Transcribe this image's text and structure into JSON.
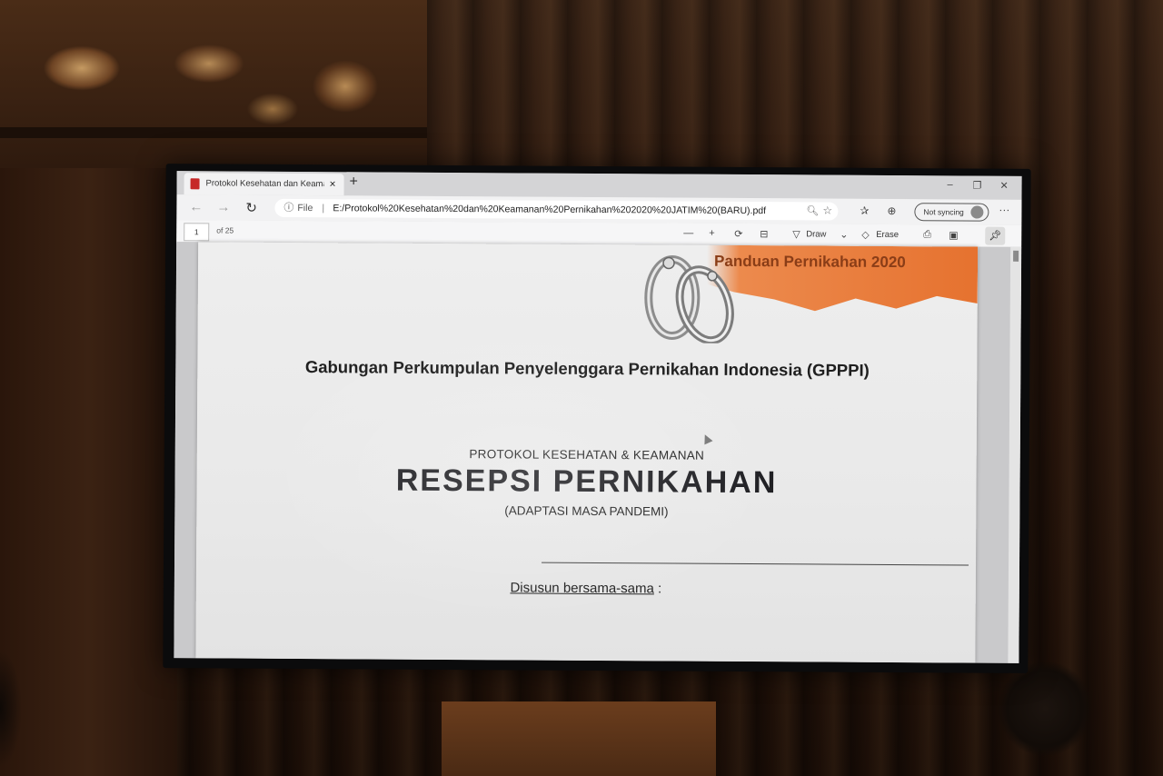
{
  "browser": {
    "tab_title": "Protokol Kesehatan dan Keaman",
    "tab_close": "×",
    "new_tab": "+",
    "window_minimize": "–",
    "window_restore": "❐",
    "window_close": "✕",
    "address": {
      "scheme": "File",
      "separator": "|",
      "path": "E:/Protokol%20Kesehatan%20dan%20Keamanan%20Pernikahan%202020%20JATIM%20(BARU).pdf"
    },
    "sync_label": "Not syncing",
    "more": "···"
  },
  "pdf_toolbar": {
    "page_number": "1",
    "page_total": "of 25",
    "draw_label": "Draw",
    "erase_label": "Erase"
  },
  "document": {
    "banner_title": "Panduan Pernikahan 2020",
    "organization": "Gabungan Perkumpulan Penyelenggara Pernikahan Indonesia (GPPPI)",
    "protocol_line": "PROTOKOL KESEHATAN & KEAMANAN",
    "main_title": "RESEPSI PERNIKAHAN",
    "subtitle": "(ADAPTASI MASA PANDEMI)",
    "compiled_by": "Disusun bersama-sama",
    "compiled_colon": " :"
  },
  "colors": {
    "banner_orange": "#e6722f",
    "pdf_icon_red": "#c62828"
  }
}
